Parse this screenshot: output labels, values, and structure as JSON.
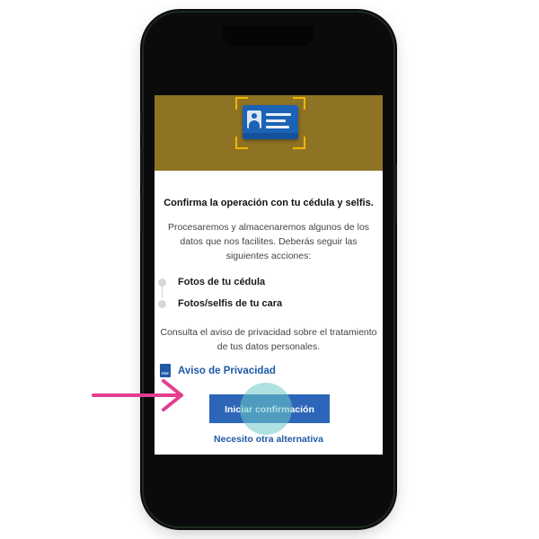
{
  "confirmation": {
    "title": "Confirma la operación con tu cédula y selfis.",
    "description": "Procesaremos y almacenaremos algunos de los datos que nos facilites. Deberás seguir las siguientes acciones:",
    "steps": [
      {
        "label": "Fotos de tu cédula"
      },
      {
        "label": "Fotos/selfis de tu cara"
      }
    ],
    "privacy_text": "Consulta el aviso de privacidad sobre el tratamiento de tus datos personales.",
    "privacy_link": {
      "icon": "pdf-icon",
      "icon_text": "PDF",
      "label": "Aviso de Privacidad"
    },
    "primary_button": "Iniciar confirmación",
    "alternative_link": "Necesito otra alternativa"
  },
  "banner": {
    "icon": "id-card-icon",
    "background_color": "#8f7325",
    "frame_color": "#f2b600"
  },
  "annotation": {
    "icon": "pointer-arrow",
    "color": "#e33e8f"
  },
  "colors": {
    "primary": "#2d66b8",
    "link": "#1f5aa6",
    "tap_highlight": "#6ec8c8"
  }
}
